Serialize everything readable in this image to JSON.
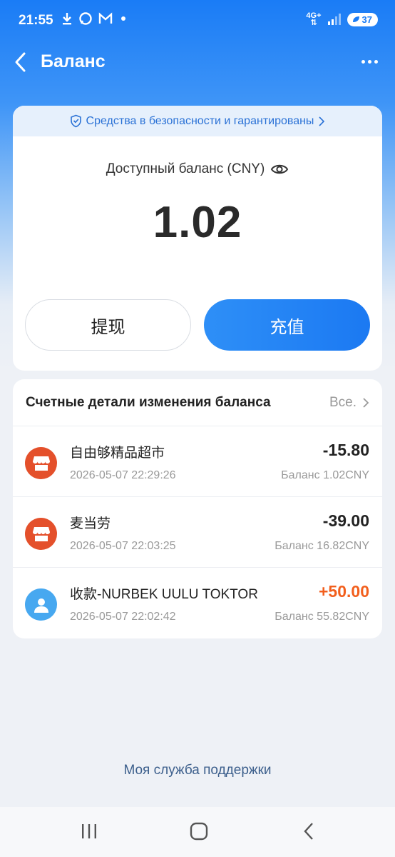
{
  "status_bar": {
    "time": "21:55",
    "network": "4G+",
    "battery": "37"
  },
  "header": {
    "title": "Баланс"
  },
  "balance_card": {
    "security_text": "Средства в безопасности и гарантированы",
    "label": "Доступный баланс (CNY)",
    "amount": "1.02",
    "withdraw_label": "提现",
    "topup_label": "充值"
  },
  "transactions": {
    "title": "Счетные детали изменения баланса",
    "view_all": "Все.",
    "items": [
      {
        "name": "自由够精品超市",
        "date": "2026-05-07 22:29:26",
        "amount": "-15.80",
        "balance": "Баланс 1.02CNY",
        "icon": "store-icon"
      },
      {
        "name": "麦当劳",
        "date": "2026-05-07 22:03:25",
        "amount": "-39.00",
        "balance": "Баланс 16.82CNY",
        "icon": "store-icon"
      },
      {
        "name": "收款-NURBEK UULU TOKTOR",
        "date": "2026-05-07 22:02:42",
        "amount": "+50.00",
        "balance": "Баланс 55.82CNY",
        "icon": "user-icon"
      }
    ]
  },
  "support_link": "Моя служба поддержки",
  "colors": {
    "accent": "#1a7cf6",
    "positive_amount": "#f25f1d",
    "store_icon_bg": "#e4502b",
    "person_icon_bg": "#47a8f0"
  }
}
